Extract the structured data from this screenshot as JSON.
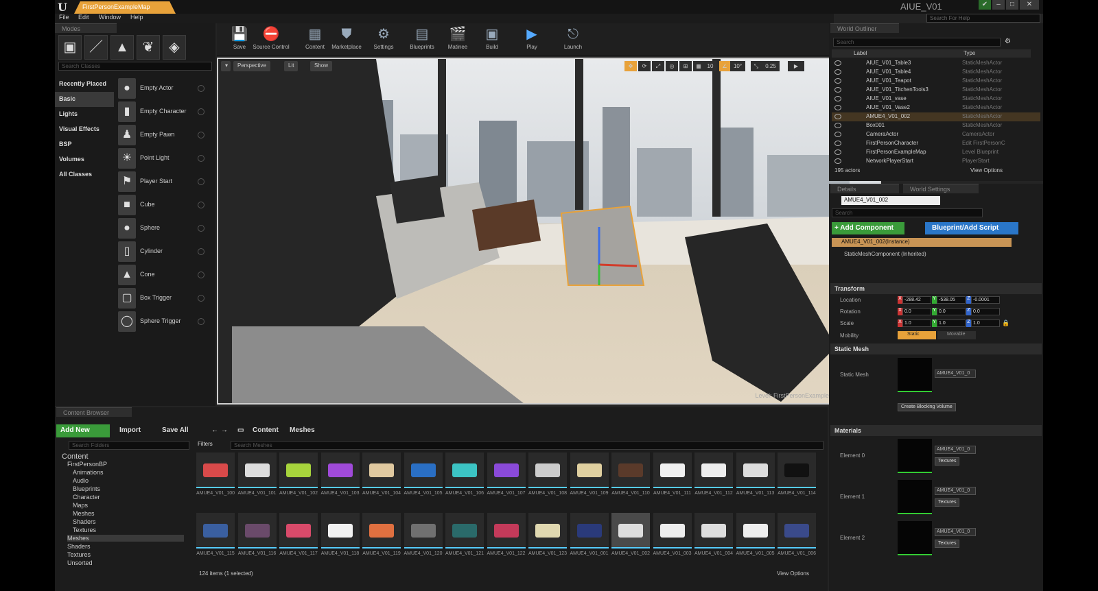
{
  "app": {
    "map_tab": "FirstPersonExampleMap",
    "project": "AIUE_V01",
    "help_search": "Search For Help"
  },
  "menu": [
    "File",
    "Edit",
    "Window",
    "Help"
  ],
  "modes": {
    "tab": "Modes",
    "search_placeholder": "Search Classes",
    "categories": [
      "Recently Placed",
      "Basic",
      "Lights",
      "Visual Effects",
      "BSP",
      "Volumes",
      "All Classes"
    ],
    "items": [
      "Empty Actor",
      "Empty Character",
      "Empty Pawn",
      "Point Light",
      "Player Start",
      "Cube",
      "Sphere",
      "Cylinder",
      "Cone",
      "Box Trigger",
      "Sphere Trigger"
    ]
  },
  "toolbar": [
    "Save",
    "Source Control",
    "Content",
    "Marketplace",
    "Settings",
    "Blueprints",
    "Matinee",
    "Build",
    "Play",
    "Launch"
  ],
  "viewport": {
    "perspective": "Perspective",
    "lit": "Lit",
    "show": "Show",
    "grid": "10",
    "rot": "10°",
    "scale": "0.25",
    "level": "Level:  FirstPersonExampleMap (Persistent)"
  },
  "outliner": {
    "tab": "World Outliner",
    "search": "Search",
    "col_label": "Label",
    "col_type": "Type",
    "rows": [
      {
        "label": "AIUE_V01_Table3",
        "type": "StaticMeshActor"
      },
      {
        "label": "AIUE_V01_Table4",
        "type": "StaticMeshActor"
      },
      {
        "label": "AIUE_V01_Teapot",
        "type": "StaticMeshActor"
      },
      {
        "label": "AIUE_V01_TitchenTools3",
        "type": "StaticMeshActor"
      },
      {
        "label": "AIUE_V01_vase",
        "type": "StaticMeshActor"
      },
      {
        "label": "AIUE_V01_Vase2",
        "type": "StaticMeshActor"
      },
      {
        "label": "AMUE4_V01_002",
        "type": "StaticMeshActor"
      },
      {
        "label": "Box001",
        "type": "StaticMeshActor"
      },
      {
        "label": "CameraActor",
        "type": "CameraActor"
      },
      {
        "label": "FirstPersonCharacter",
        "type": "Edit FirstPersonC"
      },
      {
        "label": "FirstPersonExampleMap",
        "type": "Level Blueprint"
      },
      {
        "label": "NetworkPlayerStart",
        "type": "PlayerStart"
      }
    ],
    "count": "195 actors",
    "view_options": "View Options"
  },
  "details": {
    "tab": "Details",
    "tab2": "World Settings",
    "name": "AMUE4_V01_002",
    "search": "Search",
    "add_component": "+ Add Component",
    "blueprint": "Blueprint/Add Script",
    "instance": "AMUE4_V01_002(Instance)",
    "component": "StaticMeshComponent (Inherited)",
    "transform": "Transform",
    "location": "Location",
    "rotation": "Rotation",
    "scale": "Scale",
    "mobility": "Mobility",
    "loc": [
      "-288.42",
      "-538.05",
      "-0.0001"
    ],
    "rot": [
      "0.0",
      "0.0",
      "0.0"
    ],
    "scl": [
      "1.0",
      "1.0",
      "1.0"
    ],
    "static": "Static",
    "movable": "Movable",
    "static_mesh_sect": "Static Mesh",
    "static_mesh": "Static Mesh",
    "mesh_combo": "AMUE4_V01_0",
    "blocking": "Create Blocking Volume",
    "materials": "Materials",
    "elements": [
      "Element 0",
      "Element 1",
      "Element 2"
    ],
    "mat_combo": "AMUE4_V01_0",
    "textures": "Textures"
  },
  "content": {
    "tab": "Content Browser",
    "add_new": "Add New",
    "import": "Import",
    "save_all": "Save All",
    "crumb1": "Content",
    "crumb2": "Meshes",
    "search_folders": "Search Folders",
    "filters": "Filters",
    "search_meshes": "Search Meshes",
    "tree": [
      "Content",
      "FirstPersonBP",
      "Animations",
      "Audio",
      "Blueprints",
      "Character",
      "Maps",
      "Meshes",
      "Shaders",
      "Textures",
      "Meshes",
      "Shaders",
      "Textures",
      "Unsorted"
    ],
    "row1": [
      "AMUE4_V01_100",
      "AMUE4_V01_101",
      "AMUE4_V01_102",
      "AMUE4_V01_103",
      "AMUE4_V01_104",
      "AMUE4_V01_105",
      "AMUE4_V01_106",
      "AMUE4_V01_107",
      "AMUE4_V01_108",
      "AMUE4_V01_109",
      "AMUE4_V01_110",
      "AMUE4_V01_111",
      "AMUE4_V01_112",
      "AMUE4_V01_113",
      "AMUE4_V01_114"
    ],
    "row2": [
      "AMUE4_V01_115",
      "AMUE4_V01_116",
      "AMUE4_V01_117",
      "AMUE4_V01_118",
      "AMUE4_V01_119",
      "AMUE4_V01_120",
      "AMUE4_V01_121",
      "AMUE4_V01_122",
      "AMUE4_V01_123",
      "AMUE4_V01_001",
      "AMUE4_V01_002",
      "AMUE4_V01_003",
      "AMUE4_V01_004",
      "AMUE4_V01_005",
      "AMUE4_V01_006"
    ],
    "status": "124 items (1 selected)",
    "view_options": "View Options"
  }
}
